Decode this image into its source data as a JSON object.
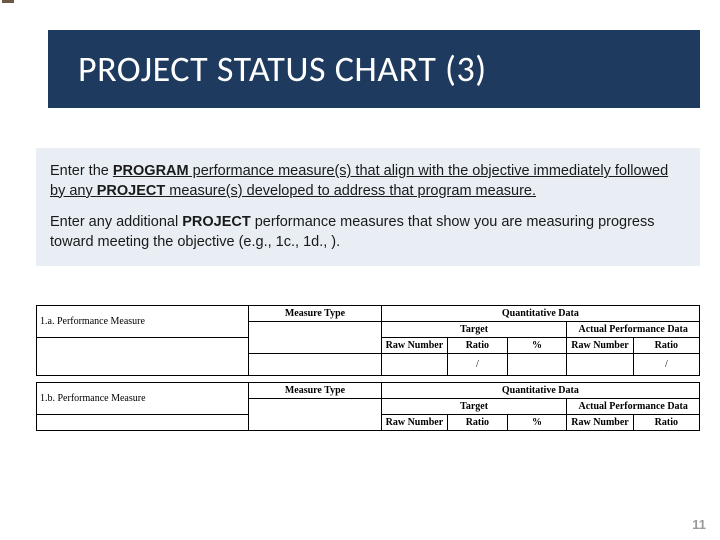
{
  "slide": {
    "title": "PROJECT STATUS CHART (3)",
    "page_number": "11",
    "body": {
      "p1_a": "Enter the ",
      "p1_b": "PROGRAM",
      "p1_c": " performance measure(s) that align with the objective immediately followed by any ",
      "p1_d": "PROJECT",
      "p1_e": " measure(s) developed to address that program measure.",
      "p2_a": "Enter  any additional ",
      "p2_b": "PROJECT",
      "p2_c": " performance measures that show you are measuring progress toward meeting the objective (e.g., 1c., 1d., )."
    },
    "table_labels": {
      "row_1a": "1.a. Performance Measure",
      "row_1b": "1.b. Performance Measure",
      "measure_type": "Measure Type",
      "quantitative_data": "Quantitative Data",
      "target": "Target",
      "actual_perf_data": "Actual Performance Data",
      "raw_number": "Raw Number",
      "ratio": "Ratio",
      "percent": "%",
      "slash": "/"
    }
  }
}
